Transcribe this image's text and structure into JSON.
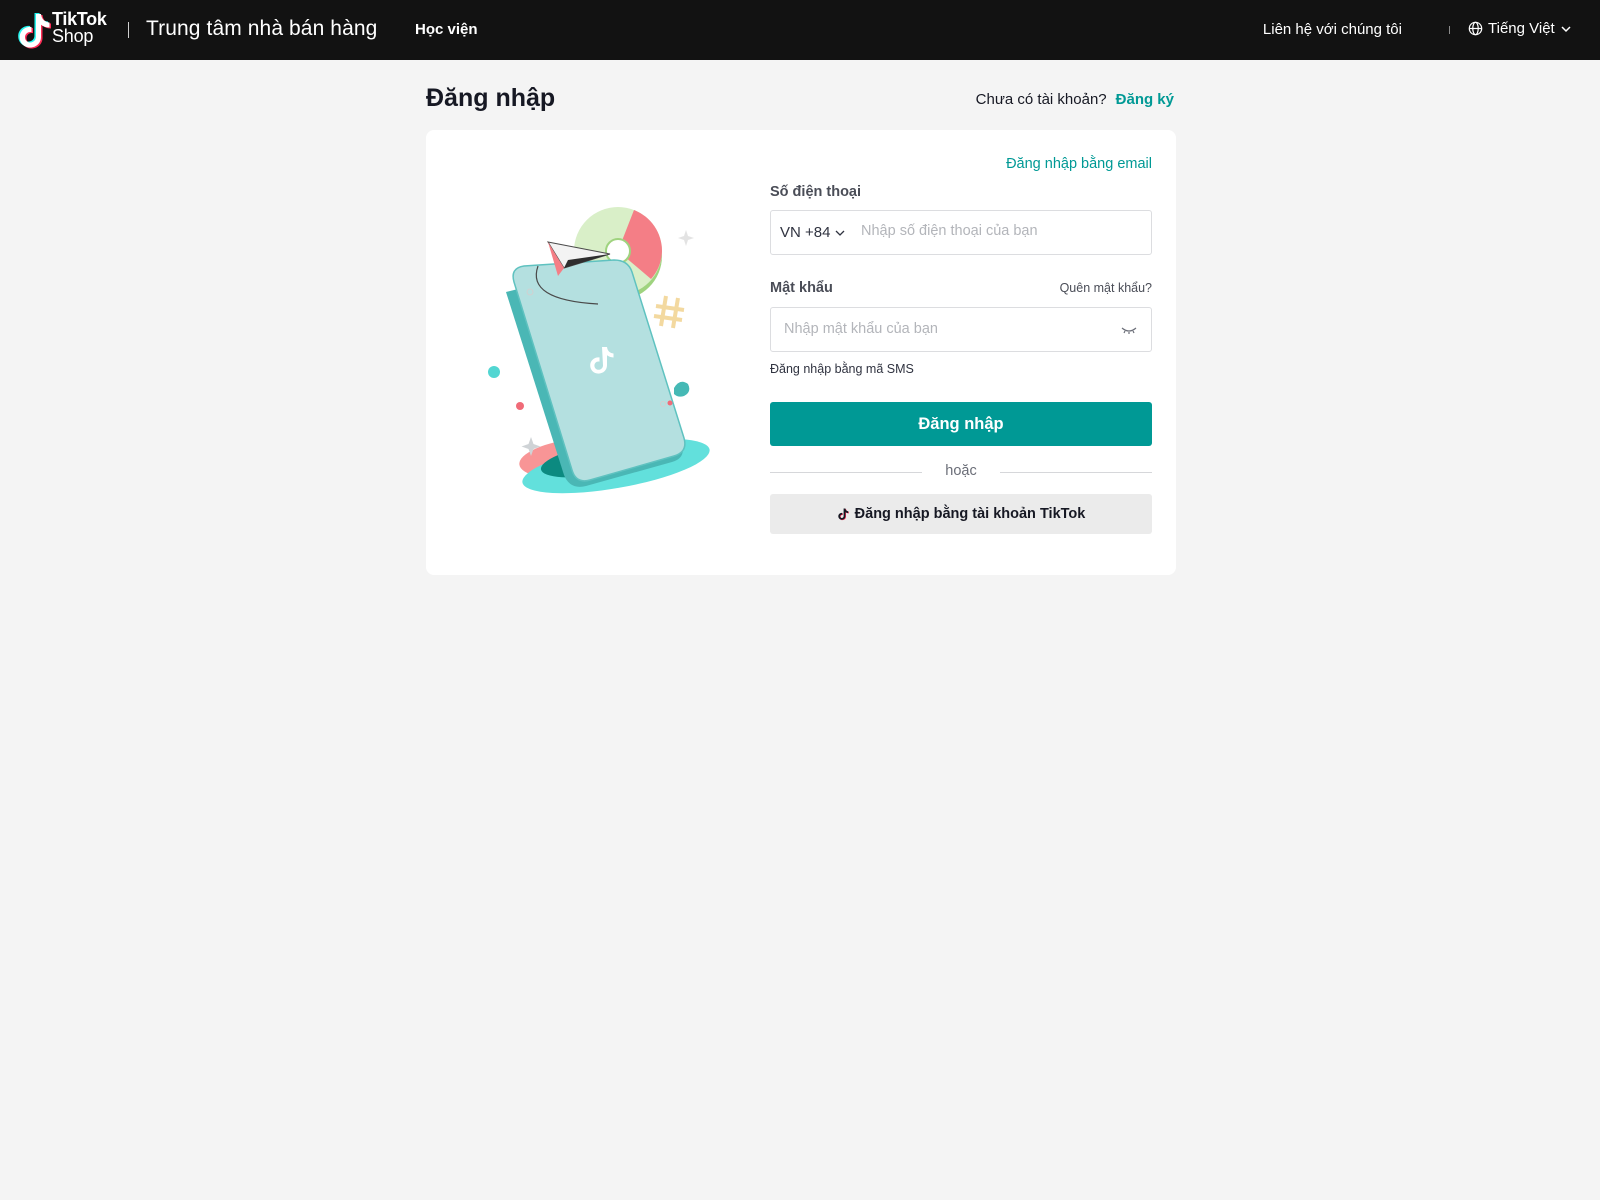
{
  "header": {
    "logo_line1": "TikTok",
    "logo_line2": "Shop",
    "site_title": "Trung tâm nhà bán hàng",
    "nav_academy": "Học viện",
    "contact": "Liên hệ với chúng tôi",
    "language": "Tiếng Việt",
    "icons": {
      "logo": "tiktok-note-icon",
      "language": "globe-icon",
      "language_caret": "chevron-down-icon"
    }
  },
  "page": {
    "title": "Đăng nhập",
    "signup_question": "Chưa có tài khoản?",
    "signup_link": "Đăng ký"
  },
  "form": {
    "email_login_link": "Đăng nhập bằng email",
    "phone_label": "Số điện thoại",
    "country_code": "VN +84",
    "phone_placeholder": "Nhập số điện thoại của bạn",
    "password_label": "Mật khẩu",
    "forgot_password": "Quên mật khẩu?",
    "password_placeholder": "Nhập mật khẩu của bạn",
    "sms_login_link": "Đăng nhập bằng mã SMS",
    "login_button": "Đăng nhập",
    "or_text": "hoặc",
    "tiktok_login_button": "Đăng nhập bằng tài khoản TikTok",
    "icons": {
      "password_toggle": "eye-closed-icon",
      "country_caret": "chevron-down-icon",
      "tiktok_button": "tiktok-note-icon"
    }
  },
  "colors": {
    "topbar": "#121212",
    "background": "#f4f4f4",
    "accent": "#009995",
    "card": "#ffffff"
  }
}
